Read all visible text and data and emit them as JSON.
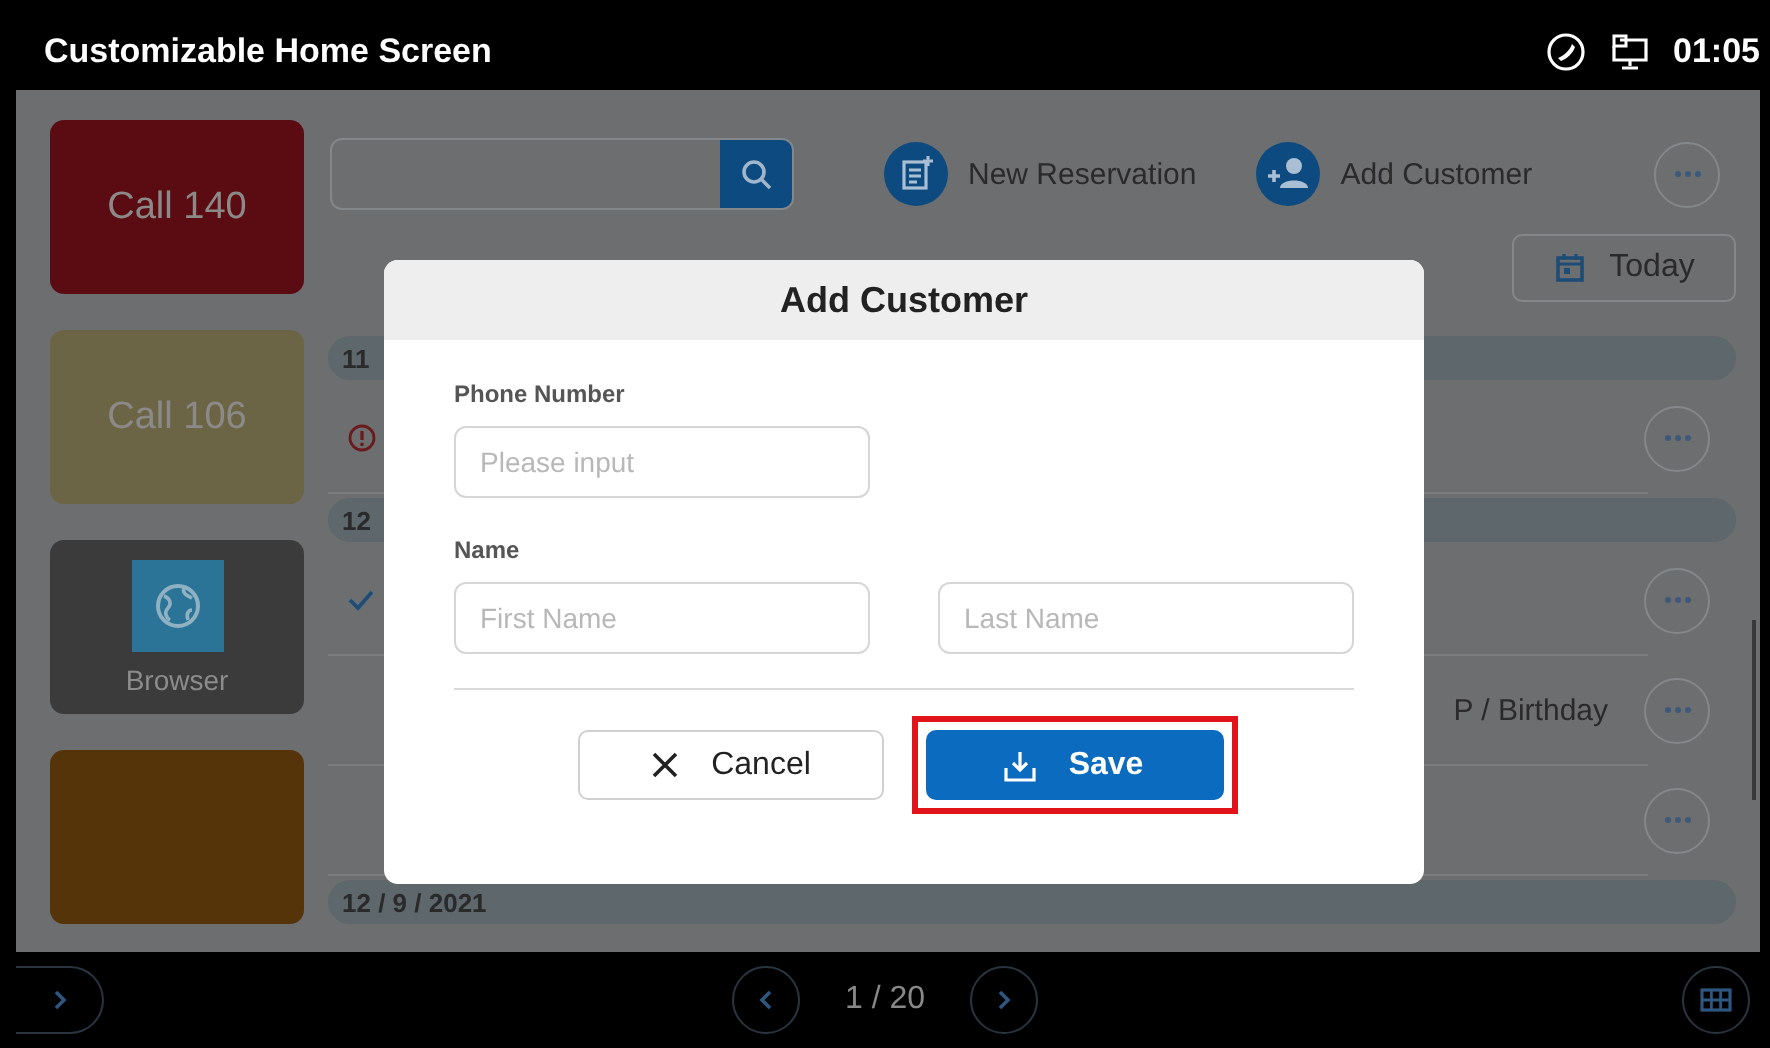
{
  "status_bar": {
    "title": "Customizable Home Screen",
    "time": "01:05"
  },
  "shortcuts": [
    {
      "kind": "tile",
      "label": "Call 140",
      "color": "#5b0c13"
    },
    {
      "kind": "tile",
      "label": "Call 106",
      "color": "#6b6546"
    },
    {
      "kind": "app",
      "label": "Browser",
      "color": "#3b3b3c"
    },
    {
      "kind": "tile",
      "color": "#563409"
    }
  ],
  "toolbar": {
    "actions": [
      {
        "kind": "reservation",
        "label": "New Reservation"
      },
      {
        "kind": "customer",
        "label": "Add Customer"
      }
    ],
    "date_button": {
      "label": "Today"
    }
  },
  "list": [
    {
      "kind": "header",
      "label": "11"
    },
    {
      "kind": "alert"
    },
    {
      "kind": "header",
      "label": "12"
    },
    {
      "kind": "done"
    },
    {
      "kind": "row",
      "text": "P / Birthday"
    },
    {
      "kind": "row"
    },
    {
      "kind": "header",
      "label": "12 / 9 / 2021"
    }
  ],
  "dialog": {
    "title": "Add Customer",
    "fields": [
      {
        "label": "Phone Number",
        "inputs": [
          {
            "placeholder": "Please input"
          }
        ]
      },
      {
        "label": "Name",
        "inputs": [
          {
            "placeholder": "First Name"
          },
          {
            "placeholder": "Last Name"
          }
        ]
      }
    ],
    "buttons": [
      {
        "kind": "cancel",
        "label": "Cancel",
        "highlighted": false
      },
      {
        "kind": "save",
        "label": "Save",
        "highlighted": true
      }
    ]
  },
  "pager": {
    "page": "1 / 20"
  }
}
